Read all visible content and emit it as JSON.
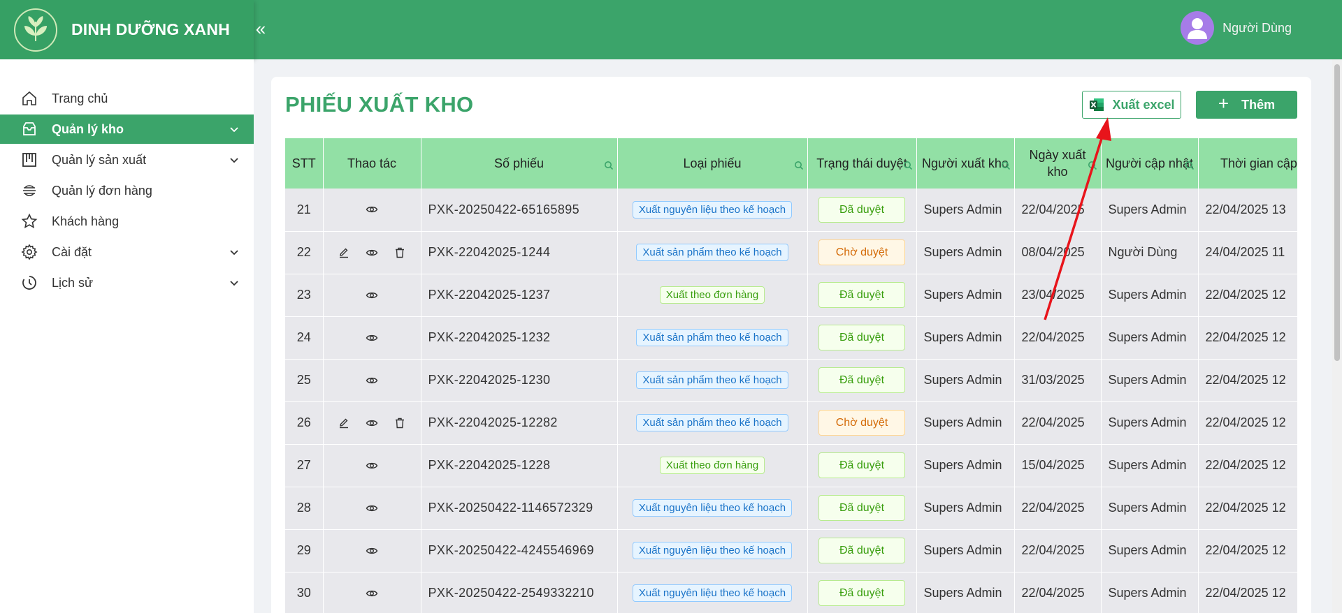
{
  "brand": {
    "name": "DINH DƯỠNG XANH"
  },
  "header": {
    "collapse_icon": "«",
    "user_name": "Người Dùng"
  },
  "sidebar": {
    "items": [
      {
        "label": "Trang chủ",
        "icon": "home-icon",
        "expandable": false,
        "active": false
      },
      {
        "label": "Quản lý kho",
        "icon": "warehouse-icon",
        "expandable": true,
        "active": true
      },
      {
        "label": "Quản lý sản xuất",
        "icon": "production-icon",
        "expandable": true,
        "active": false
      },
      {
        "label": "Quản lý đơn hàng",
        "icon": "order-icon",
        "expandable": false,
        "active": false
      },
      {
        "label": "Khách hàng",
        "icon": "star-icon",
        "expandable": false,
        "active": false
      },
      {
        "label": "Cài đặt",
        "icon": "gear-icon",
        "expandable": true,
        "active": false
      },
      {
        "label": "Lịch sử",
        "icon": "history-icon",
        "expandable": true,
        "active": false
      }
    ]
  },
  "page": {
    "title": "PHIẾU XUẤT KHO",
    "export_label": "Xuất excel",
    "add_label": "Thêm"
  },
  "table": {
    "columns": [
      {
        "label": "STT",
        "search": false
      },
      {
        "label": "Thao tác",
        "search": false
      },
      {
        "label": "Số phiếu",
        "search": true
      },
      {
        "label": "Loại phiếu",
        "search": true
      },
      {
        "label": "Trạng thái duyệt",
        "search": true
      },
      {
        "label": "Người xuất kho",
        "search": true
      },
      {
        "label": "Ngày xuất kho",
        "search": true
      },
      {
        "label": "Người cập nhật",
        "search": true
      },
      {
        "label": "Thời gian cập nhật",
        "search": false
      }
    ],
    "rows": [
      {
        "stt": "21",
        "editable": false,
        "so_phieu": "PXK-20250422-65165895",
        "loai": "Xuất nguyên liệu theo kế hoạch",
        "loai_color": "blue",
        "trang_thai": "Đã duyệt",
        "status_kind": "ok",
        "nguoi_xuat": "Supers Admin",
        "ngay": "22/04/2025",
        "nguoi_cap_nhat": "Supers Admin",
        "thoi_gian": "22/04/2025 13"
      },
      {
        "stt": "22",
        "editable": true,
        "so_phieu": "PXK-22042025-1244",
        "loai": "Xuất sản phẩm theo kế hoạch",
        "loai_color": "blue",
        "trang_thai": "Chờ duyệt",
        "status_kind": "wait",
        "nguoi_xuat": "Supers Admin",
        "ngay": "08/04/2025",
        "nguoi_cap_nhat": "Người Dùng",
        "thoi_gian": "24/04/2025 11"
      },
      {
        "stt": "23",
        "editable": false,
        "so_phieu": "PXK-22042025-1237",
        "loai": "Xuất theo đơn hàng",
        "loai_color": "green",
        "trang_thai": "Đã duyệt",
        "status_kind": "ok",
        "nguoi_xuat": "Supers Admin",
        "ngay": "23/04/2025",
        "nguoi_cap_nhat": "Supers Admin",
        "thoi_gian": "22/04/2025 12"
      },
      {
        "stt": "24",
        "editable": false,
        "so_phieu": "PXK-22042025-1232",
        "loai": "Xuất sản phẩm theo kế hoạch",
        "loai_color": "blue",
        "trang_thai": "Đã duyệt",
        "status_kind": "ok",
        "nguoi_xuat": "Supers Admin",
        "ngay": "22/04/2025",
        "nguoi_cap_nhat": "Supers Admin",
        "thoi_gian": "22/04/2025 12"
      },
      {
        "stt": "25",
        "editable": false,
        "so_phieu": "PXK-22042025-1230",
        "loai": "Xuất sản phẩm theo kế hoạch",
        "loai_color": "blue",
        "trang_thai": "Đã duyệt",
        "status_kind": "ok",
        "nguoi_xuat": "Supers Admin",
        "ngay": "31/03/2025",
        "nguoi_cap_nhat": "Supers Admin",
        "thoi_gian": "22/04/2025 12"
      },
      {
        "stt": "26",
        "editable": true,
        "so_phieu": "PXK-22042025-12282",
        "loai": "Xuất sản phẩm theo kế hoạch",
        "loai_color": "blue",
        "trang_thai": "Chờ duyệt",
        "status_kind": "wait",
        "nguoi_xuat": "Supers Admin",
        "ngay": "22/04/2025",
        "nguoi_cap_nhat": "Supers Admin",
        "thoi_gian": "22/04/2025 12"
      },
      {
        "stt": "27",
        "editable": false,
        "so_phieu": "PXK-22042025-1228",
        "loai": "Xuất theo đơn hàng",
        "loai_color": "green",
        "trang_thai": "Đã duyệt",
        "status_kind": "ok",
        "nguoi_xuat": "Supers Admin",
        "ngay": "15/04/2025",
        "nguoi_cap_nhat": "Supers Admin",
        "thoi_gian": "22/04/2025 12"
      },
      {
        "stt": "28",
        "editable": false,
        "so_phieu": "PXK-20250422-1146572329",
        "loai": "Xuất nguyên liệu theo kế hoạch",
        "loai_color": "blue",
        "trang_thai": "Đã duyệt",
        "status_kind": "ok",
        "nguoi_xuat": "Supers Admin",
        "ngay": "22/04/2025",
        "nguoi_cap_nhat": "Supers Admin",
        "thoi_gian": "22/04/2025 12"
      },
      {
        "stt": "29",
        "editable": false,
        "so_phieu": "PXK-20250422-4245546969",
        "loai": "Xuất nguyên liệu theo kế hoạch",
        "loai_color": "blue",
        "trang_thai": "Đã duyệt",
        "status_kind": "ok",
        "nguoi_xuat": "Supers Admin",
        "ngay": "22/04/2025",
        "nguoi_cap_nhat": "Supers Admin",
        "thoi_gian": "22/04/2025 12"
      },
      {
        "stt": "30",
        "editable": false,
        "so_phieu": "PXK-20250422-2549332210",
        "loai": "Xuất nguyên liệu theo kế hoạch",
        "loai_color": "blue",
        "trang_thai": "Đã duyệt",
        "status_kind": "ok",
        "nguoi_xuat": "Supers Admin",
        "ngay": "22/04/2025",
        "nguoi_cap_nhat": "Supers Admin",
        "thoi_gian": "22/04/2025 12"
      }
    ]
  },
  "colors": {
    "primary": "#3ba46a",
    "header_cell": "#92e0a5",
    "row": "#e8e8ec",
    "annotation_arrow": "#e8141b"
  }
}
